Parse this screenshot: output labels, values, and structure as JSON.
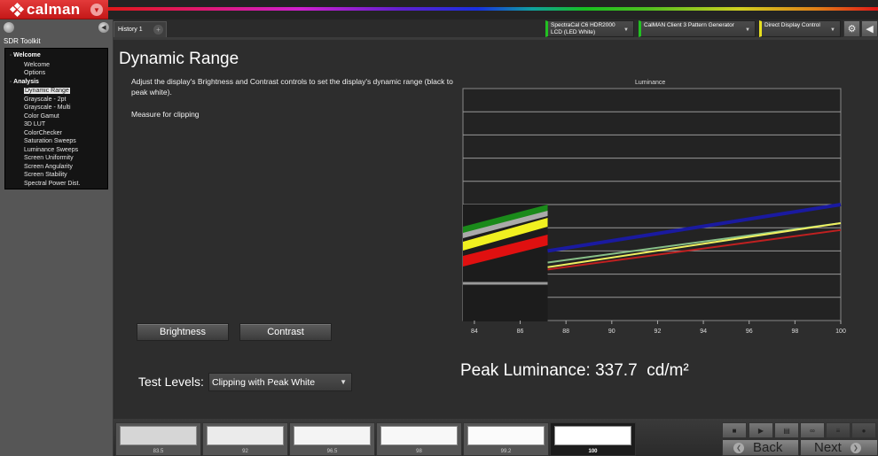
{
  "app": {
    "brand": "calman",
    "colors": {
      "brand_red": "#d42222",
      "accent_green": "#22c022",
      "accent_yellow": "#e8e020"
    }
  },
  "left_panel": {
    "title": "SDR Toolkit",
    "groups": [
      {
        "label": "Welcome",
        "items": [
          "Welcome",
          "Options"
        ]
      },
      {
        "label": "Analysis",
        "items": [
          "Dynamic Range",
          "Grayscale - 2pt",
          "Grayscale - Multi",
          "Color Gamut",
          "3D LUT",
          "ColorChecker",
          "Saturation Sweeps",
          "Luminance Sweeps",
          "Screen Uniformity",
          "Screen Angularity",
          "Screen Stability",
          "Spectral Power Dist."
        ]
      }
    ],
    "active_item": "Dynamic Range"
  },
  "tabs": [
    {
      "label": "History 1"
    }
  ],
  "devices": [
    {
      "line1": "SpectraCal C6 HDR2000",
      "line2": "LCD (LED White)",
      "status_color": "#22c022"
    },
    {
      "line1": "CalMAN Client 3 Pattern Generator",
      "line2": "",
      "status_color": "#22c022"
    },
    {
      "line1": "Direct Display Control",
      "line2": "",
      "status_color": "#e8e020"
    }
  ],
  "main": {
    "title": "Dynamic Range",
    "description": "Adjust the display's Brightness and Contrast controls to set the display's dynamic range (black to peak white).",
    "measure_text": "Measure for clipping",
    "brightness_label": "Brightness",
    "contrast_label": "Contrast",
    "test_levels_label": "Test Levels:",
    "test_levels_value": "Clipping with Peak White",
    "peak_label": "Peak Luminance: 337.7",
    "peak_unit": "cd/m²"
  },
  "chart_data": {
    "type": "line",
    "title": "Luminance",
    "xlabel": "",
    "ylabel": "",
    "x_ticks": [
      "84",
      "86",
      "88",
      "90",
      "92",
      "94",
      "96",
      "98",
      "100"
    ],
    "xlim": [
      83.5,
      100
    ],
    "grid": true,
    "series": [
      {
        "name": "Blue",
        "color": "#1a1aa0",
        "x": [
          87.2,
          100
        ],
        "y": [
          0.3,
          0.5
        ]
      },
      {
        "name": "Green",
        "color": "#88c088",
        "x": [
          87.2,
          100
        ],
        "y": [
          0.25,
          0.42
        ]
      },
      {
        "name": "Yellow",
        "color": "#f0f060",
        "x": [
          87.2,
          100
        ],
        "y": [
          0.23,
          0.42
        ]
      },
      {
        "name": "Red",
        "color": "#c02020",
        "x": [
          87.2,
          100
        ],
        "y": [
          0.22,
          0.39
        ]
      }
    ],
    "inset_legend": [
      "Green/Gray",
      "Yellow",
      "Red",
      "Gray"
    ]
  },
  "swatches": [
    {
      "label": "83.5",
      "color": "#d6d6d6"
    },
    {
      "label": "92",
      "color": "#ebebeb"
    },
    {
      "label": "96.5",
      "color": "#f4f4f4"
    },
    {
      "label": "98",
      "color": "#f8f8f8"
    },
    {
      "label": "99.2",
      "color": "#fbfbfb"
    },
    {
      "label": "100",
      "color": "#ffffff"
    }
  ],
  "active_swatch": "100",
  "nav": {
    "back_label": "Back",
    "next_label": "Next"
  }
}
